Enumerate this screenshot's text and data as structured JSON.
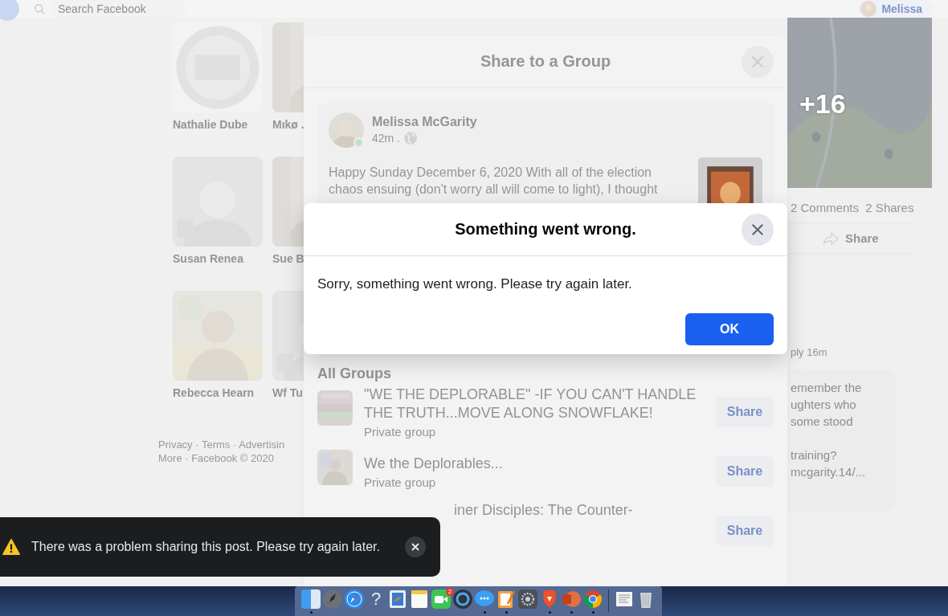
{
  "top_bar": {
    "search_placeholder": "Search Facebook",
    "profile_name": "Melissa"
  },
  "friends": [
    {
      "name": "Nathalie Dube"
    },
    {
      "name": "Mıkø ."
    },
    {
      "name": "Susan Renea"
    },
    {
      "name": "Sue B"
    },
    {
      "name": "Rebecca Hearn"
    },
    {
      "name": "Wf Tu"
    }
  ],
  "footer": [
    "Privacy · Terms · Advertisin",
    "More · Facebook © 2020"
  ],
  "post": {
    "more_photos": "+16",
    "counts": "2 Comments  2 Shares",
    "share_button": "Share",
    "reply_meta": "ply 16m",
    "comment_lines": [
      "emember the",
      "ughters who",
      "some stood",
      "training?",
      "mcgarity.14/..."
    ]
  },
  "share_dialog": {
    "title": "Share to a Group",
    "post": {
      "author": "Melissa McGarity",
      "time": "42m .",
      "online": true,
      "text_lines": [
        "Happy Sunday December 6, 2020 With all of the election",
        "chaos ensuing (don't worry all will come to light), I thought"
      ]
    },
    "section_title": "All Groups",
    "groups": [
      {
        "name": "\"WE THE DEPLORABLE\" -IF YOU CAN'T HANDLE THE TRUTH...MOVE ALONG SNOWFLAKE!",
        "subtitle": "Private group",
        "button": "Share"
      },
      {
        "name": "We the Deplorables...",
        "subtitle": "Private group",
        "button": "Share"
      },
      {
        "name": "iner Disciples: The Counter-",
        "button": "Share"
      }
    ]
  },
  "error_dialog": {
    "title": "Something went wrong.",
    "message": "Sorry, something went wrong. Please try again later.",
    "button": "OK"
  },
  "toast": {
    "message": "There was a problem sharing this post. Please try again later."
  },
  "dock": {
    "apps": [
      {
        "kind": "finder",
        "running": true
      },
      {
        "kind": "launchpad",
        "running": false
      },
      {
        "kind": "safari",
        "running": false
      },
      {
        "kind": "help",
        "glyph": "?",
        "running": false
      },
      {
        "kind": "preview",
        "running": false
      },
      {
        "kind": "notes",
        "running": false
      },
      {
        "kind": "facetime",
        "badge": "2",
        "running": false
      },
      {
        "kind": "quicktime",
        "running": false
      },
      {
        "kind": "messages",
        "running": true
      },
      {
        "kind": "pages",
        "running": true
      },
      {
        "kind": "preferences",
        "running": false
      },
      {
        "kind": "brave",
        "running": true
      },
      {
        "kind": "powerpoint",
        "running": true
      },
      {
        "kind": "chrome",
        "running": true
      },
      {
        "kind": "separator"
      },
      {
        "kind": "document",
        "running": false
      },
      {
        "kind": "trash",
        "running": false
      }
    ]
  }
}
